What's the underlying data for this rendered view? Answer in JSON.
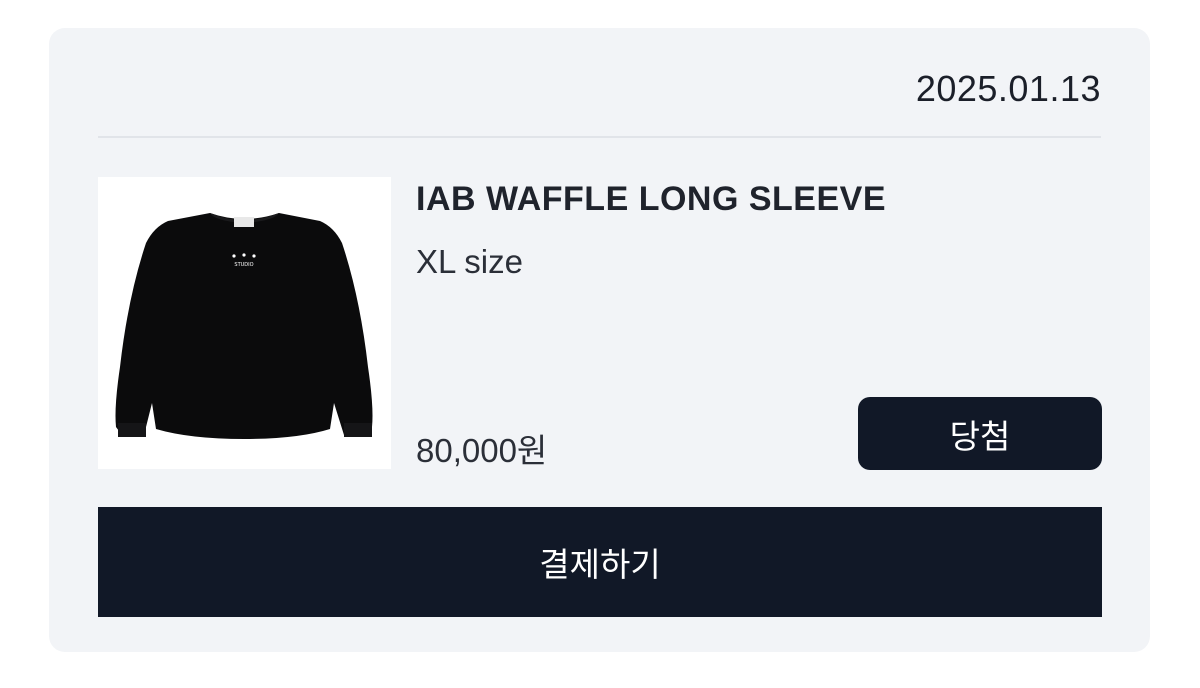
{
  "order": {
    "date": "2025.01.13",
    "product": {
      "name": "IAB WAFFLE LONG SLEEVE",
      "option": "XL size",
      "price": "80,000원",
      "image": "black-long-sleeve-shirt",
      "logo_text": "STUDIO"
    },
    "status_label": "당첨",
    "pay_button_label": "결제하기"
  },
  "colors": {
    "card_background": "#f2f4f7",
    "button_background": "#111827",
    "button_text": "#ffffff"
  }
}
